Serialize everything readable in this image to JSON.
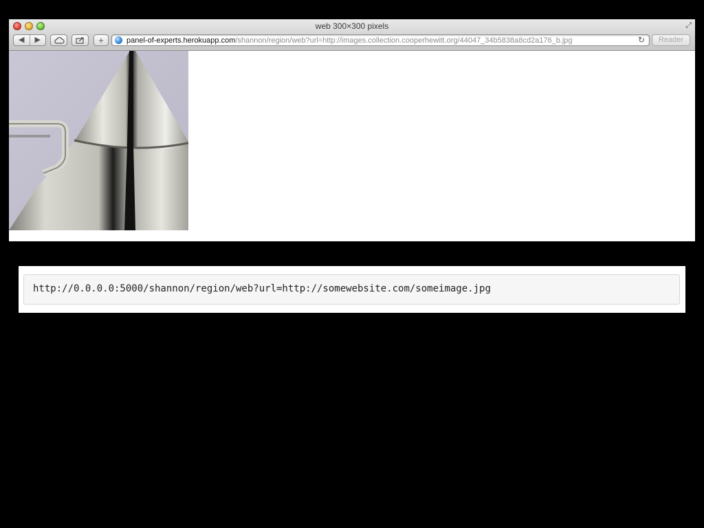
{
  "window": {
    "title": "web 300×300 pixels",
    "toolbar": {
      "back_glyph": "◀",
      "forward_glyph": "▶",
      "add_glyph": "+",
      "reload_glyph": "↻",
      "reader_label": "Reader"
    },
    "address": {
      "host": "panel-of-experts.herokuapp.com",
      "path": "/shannon/region/web?url=http://images.collection.cooperhewitt.org/44047_34b5838a8cd2a176_b.jpg"
    }
  },
  "code": {
    "text": "http://0.0.0.0:5000/shannon/region/web?url=http://somewebsite.com/someimage.jpg"
  },
  "icons": [
    "back-icon",
    "forward-icon",
    "icloud-icon",
    "share-icon",
    "add-icon",
    "globe-icon",
    "reload-icon",
    "fullscreen-icon"
  ]
}
